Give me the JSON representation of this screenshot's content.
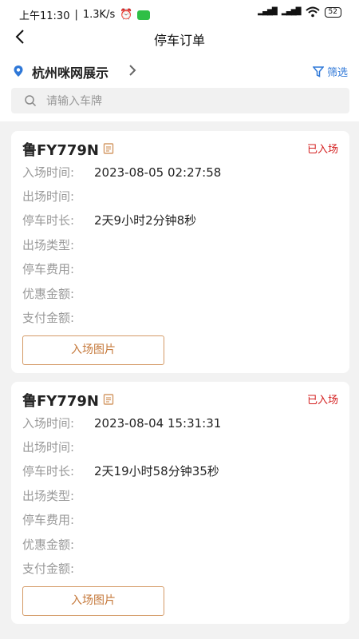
{
  "status_bar": {
    "time": "上午11:30",
    "net_speed": "1.3K/s",
    "battery": "52"
  },
  "nav": {
    "title": "停车订单"
  },
  "location": {
    "name": "杭州咪网展示",
    "filter_label": "筛选"
  },
  "search": {
    "placeholder": "请输入车牌"
  },
  "labels": {
    "entry_time": "入场时间:",
    "exit_time": "出场时间:",
    "duration": "停车时长:",
    "exit_type": "出场类型:",
    "fee": "停车费用:",
    "discount": "优惠金额:",
    "paid": "支付金额:"
  },
  "orders": [
    {
      "plate": "鲁FY779N",
      "status": "已入场",
      "entry_time": "2023-08-05 02:27:58",
      "exit_time": "",
      "duration": "2天9小时2分钟8秒",
      "exit_type": "",
      "fee": "",
      "discount": "",
      "paid": "",
      "button": "入场图片"
    },
    {
      "plate": "鲁FY779N",
      "status": "已入场",
      "entry_time": "2023-08-04 15:31:31",
      "exit_time": "",
      "duration": "2天19小时58分钟35秒",
      "exit_type": "",
      "fee": "",
      "discount": "",
      "paid": "",
      "button": "入场图片"
    }
  ],
  "colors": {
    "accent_blue": "#2f78d8",
    "status_red": "#d42020",
    "button_orange": "#c5783a"
  }
}
